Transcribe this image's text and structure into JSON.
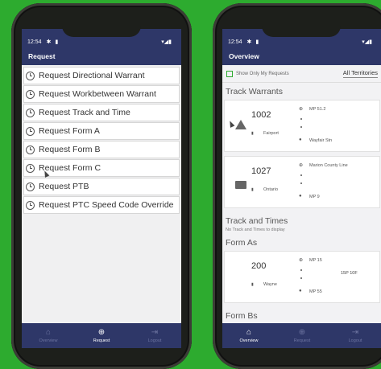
{
  "phone_left": {
    "status_time": "12:54",
    "title": "Request",
    "menu": [
      "Request Directional Warrant",
      "Request Workbetween Warrant",
      "Request Track and Time",
      "Request Form A",
      "Request Form B",
      "Request Form C",
      "Request PTB",
      "Request PTC Speed Code Override"
    ],
    "nav": [
      "Overview",
      "Request",
      "Logout"
    ]
  },
  "phone_right": {
    "status_time": "12:54",
    "title": "Overview",
    "filter_label": "Show Only My Requests",
    "territory": "All Territories",
    "sections": {
      "track_warrants": "Track Warrants",
      "track_and_times": "Track and Times",
      "track_and_times_empty": "No Track and Times to display",
      "form_as": "Form As",
      "form_bs": "Form Bs"
    },
    "warrants": [
      {
        "number": "1002",
        "location": "Fairport",
        "from": "MP 51.2",
        "to": "Wayfair Stn",
        "icon": "warning-icon"
      },
      {
        "number": "1027",
        "location": "Ontario",
        "from": "Marion County Line",
        "to": "MP 9",
        "icon": "mail-icon"
      }
    ],
    "form_a": {
      "number": "200",
      "location": "Wayne",
      "from": "MP 15",
      "to": "MP 55",
      "extra": "15P 10F"
    },
    "nav": [
      "Overview",
      "Request",
      "Logout"
    ]
  },
  "colors": {
    "background": "#2dab2f",
    "app_bar": "#2e3768",
    "accent": "#2dab2f"
  }
}
